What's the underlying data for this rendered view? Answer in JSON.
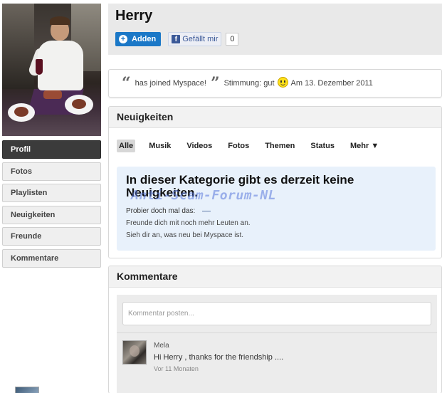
{
  "profile": {
    "name": "Herry",
    "add_label": "Adden",
    "fb_like_label": "Gefällt mir",
    "fb_like_count": "0"
  },
  "sidebar": {
    "items": [
      {
        "label": "Profil",
        "active": true
      },
      {
        "label": "Fotos",
        "active": false
      },
      {
        "label": "Playlisten",
        "active": false
      },
      {
        "label": "Neuigkeiten",
        "active": false
      },
      {
        "label": "Freunde",
        "active": false
      },
      {
        "label": "Kommentare",
        "active": false
      }
    ]
  },
  "status": {
    "text": "has joined Myspace!",
    "mood_label": "Stimmung: gut",
    "date": "Am 13. Dezember 2011"
  },
  "news": {
    "title": "Neuigkeiten",
    "tabs": [
      "Alle",
      "Musik",
      "Videos",
      "Fotos",
      "Themen",
      "Status",
      "Mehr ▼"
    ],
    "active_tab": "Alle",
    "empty_title": "In dieser Kategorie gibt es derzeit keine Neuigkeiten.",
    "watermark": "Anti-Scam-Forum-NL",
    "empty_lead": "Probier doch mal das:",
    "suggestions": [
      "Freunde dich mit noch mehr Leuten an.",
      "Sieh dir an, was neu bei Myspace ist."
    ]
  },
  "comments": {
    "title": "Kommentare",
    "input_placeholder": "Kommentar posten...",
    "items": [
      {
        "author": "Mela",
        "text": "Hi Herry , thanks for the friendship ....",
        "time": "Vor 11 Monaten"
      }
    ]
  },
  "colors": {
    "accent_blue": "#1b78c7",
    "facebook_blue": "#3b5998",
    "nav_active": "#3b3b3b",
    "empty_box_bg": "#e8f1fb"
  }
}
